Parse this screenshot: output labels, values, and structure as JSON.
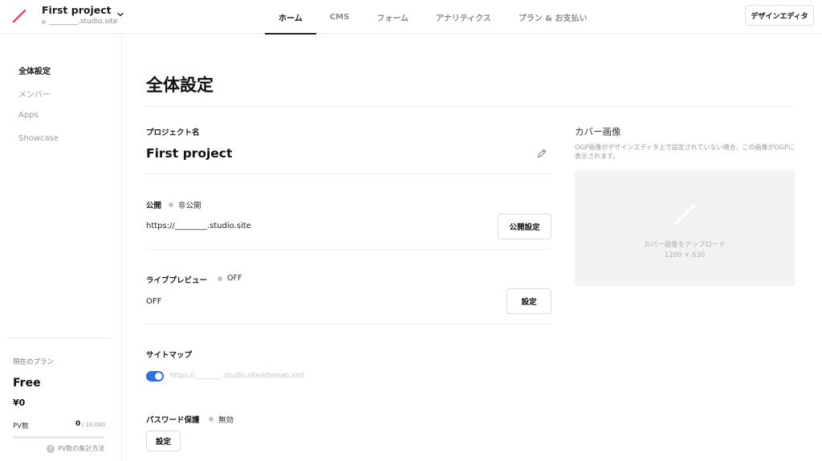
{
  "header": {
    "project_title": "First project",
    "project_url": "________.studio.site",
    "tabs": [
      {
        "label": "ホーム",
        "active": true
      },
      {
        "label": "CMS",
        "active": false
      },
      {
        "label": "フォーム",
        "active": false
      },
      {
        "label": "アナリティクス",
        "active": false
      },
      {
        "label": "プラン & お支払い",
        "active": false
      }
    ],
    "design_editor_label": "デザインエディタ",
    "brand_color": "#e8407a"
  },
  "sidebar": {
    "items": [
      {
        "label": "全体設定",
        "active": true
      },
      {
        "label": "メンバー",
        "active": false
      },
      {
        "label": "Apps",
        "active": false
      },
      {
        "label": "Showcase",
        "active": false
      }
    ],
    "plan": {
      "label": "現在のプラン",
      "name": "Free",
      "price": "¥0",
      "pv_label": "PV数",
      "pv_count": "0",
      "pv_max": "/ 10,000",
      "pv_usage_fraction": 0,
      "help_label": "PV数の集計方法"
    }
  },
  "main": {
    "title": "全体設定",
    "project_name": {
      "label": "プロジェクト名",
      "value": "First project"
    },
    "publish": {
      "label": "公開",
      "status": "非公開",
      "url": "https://________.studio.site",
      "button": "公開設定"
    },
    "live_preview": {
      "label": "ライブプレビュー",
      "status": "OFF",
      "value": "OFF",
      "button": "設定"
    },
    "sitemap": {
      "label": "サイトマップ",
      "enabled": true,
      "url": "https://________.studio.site/sitemap.xml"
    },
    "password": {
      "label": "パスワード保護",
      "status": "無効",
      "button": "設定"
    }
  },
  "cover": {
    "title": "カバー画像",
    "description": "OGP画像がデザインエディタ上で設定されていない場合、この画像がOGPに表示されます。",
    "upload_label": "カバー画像をアップロード",
    "size": "1200 × 630"
  }
}
